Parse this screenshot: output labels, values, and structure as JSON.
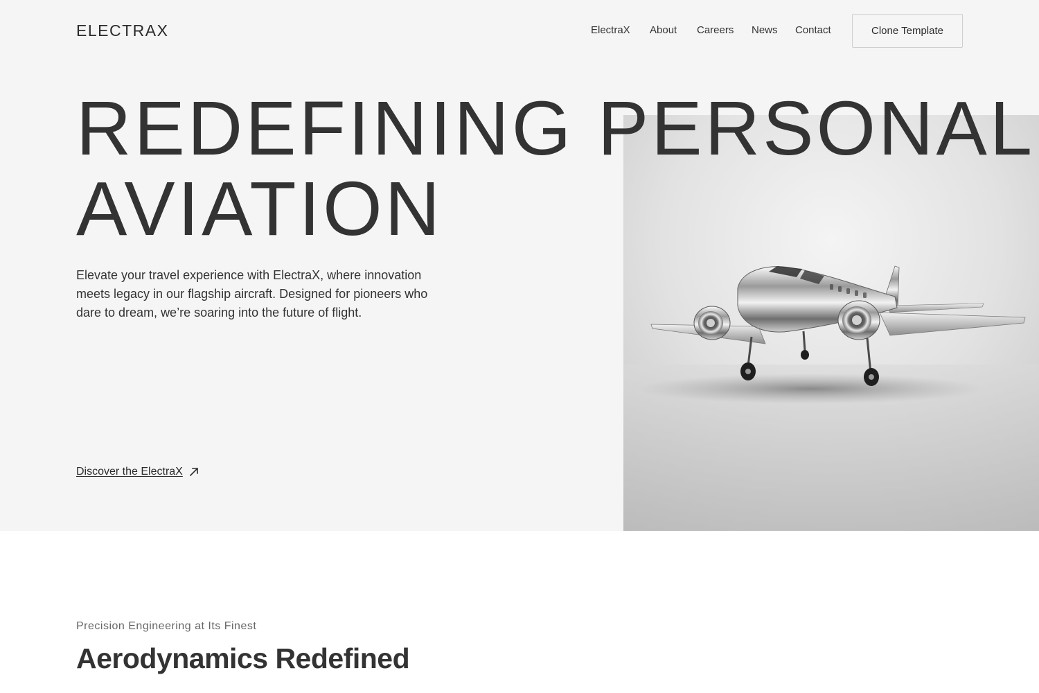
{
  "header": {
    "logo": "ELECTRAX",
    "nav": [
      {
        "label": "ElectraX"
      },
      {
        "label": "About"
      },
      {
        "label": "Careers"
      },
      {
        "label": "News"
      },
      {
        "label": "Contact"
      }
    ],
    "cta_label": "Clone Template"
  },
  "hero": {
    "headline_line1": "REDEFINING PERSONAL",
    "headline_line2": "AVIATION",
    "intro": "Elevate your travel experience with ElectraX, where innovation meets legacy in our flagship aircraft. Designed for pioneers who dare to dream, we’re soaring into the future of flight.",
    "discover_label": "Discover the ElectraX",
    "discover_icon": "arrow-up-right-icon",
    "image_icon": "aircraft-photo"
  },
  "section": {
    "eyebrow": "Precision Engineering at Its Finest",
    "title": "Aerodynamics Redefined"
  },
  "colors": {
    "hero_background": "#f5f5f5",
    "text": "#333333",
    "muted_text": "#666666",
    "button_border": "#cfcfcf"
  }
}
